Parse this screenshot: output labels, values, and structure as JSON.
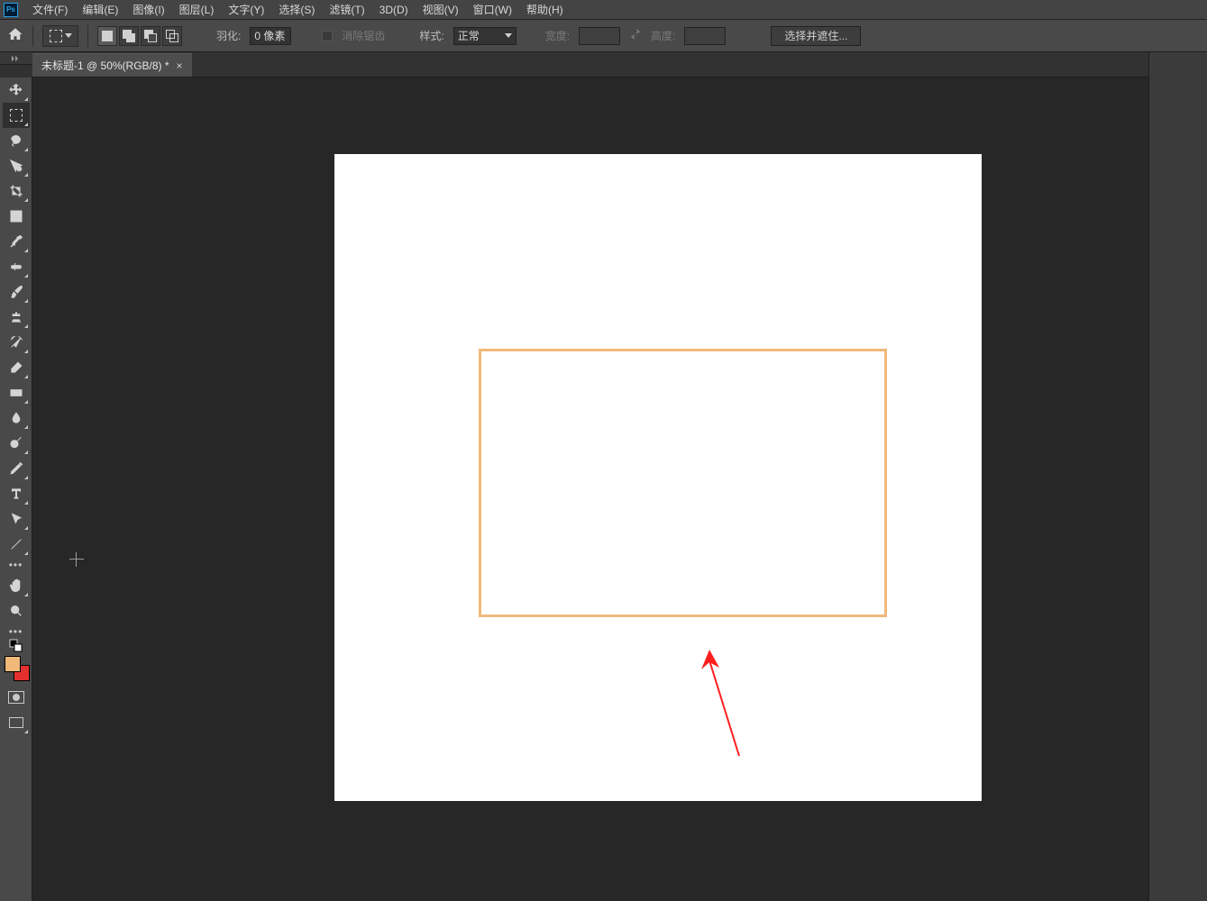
{
  "menubar": {
    "items": [
      "文件(F)",
      "编辑(E)",
      "图像(I)",
      "图层(L)",
      "文字(Y)",
      "选择(S)",
      "滤镜(T)",
      "3D(D)",
      "视图(V)",
      "窗口(W)",
      "帮助(H)"
    ]
  },
  "options": {
    "feather_label": "羽化:",
    "feather_value": "0 像素",
    "antialias_label": "消除锯齿",
    "style_label": "样式:",
    "style_value": "正常",
    "width_label": "宽度:",
    "height_label": "高度:",
    "mask_button": "选择并遮住..."
  },
  "tab": {
    "title": "未标题-1 @ 50%(RGB/8) *"
  },
  "swatches": {
    "fg": "#f0b97a",
    "bg": "#e53030"
  },
  "tooltips": {
    "move": "move-tool",
    "marquee": "rect-marquee-tool",
    "lasso": "lasso-tool",
    "wand": "quick-select-tool",
    "crop": "crop-tool",
    "frame": "frame-tool",
    "eyedrop": "eyedropper-tool",
    "heal": "healing-brush-tool",
    "brush": "brush-tool",
    "stamp": "clone-stamp-tool",
    "history": "history-brush-tool",
    "eraser": "eraser-tool",
    "gradient": "gradient-tool",
    "blur": "blur-tool",
    "dodge": "dodge-tool",
    "pen": "pen-tool",
    "type": "type-tool",
    "path": "path-select-tool",
    "line": "line-tool",
    "hand": "hand-tool",
    "zoom": "zoom-tool"
  }
}
